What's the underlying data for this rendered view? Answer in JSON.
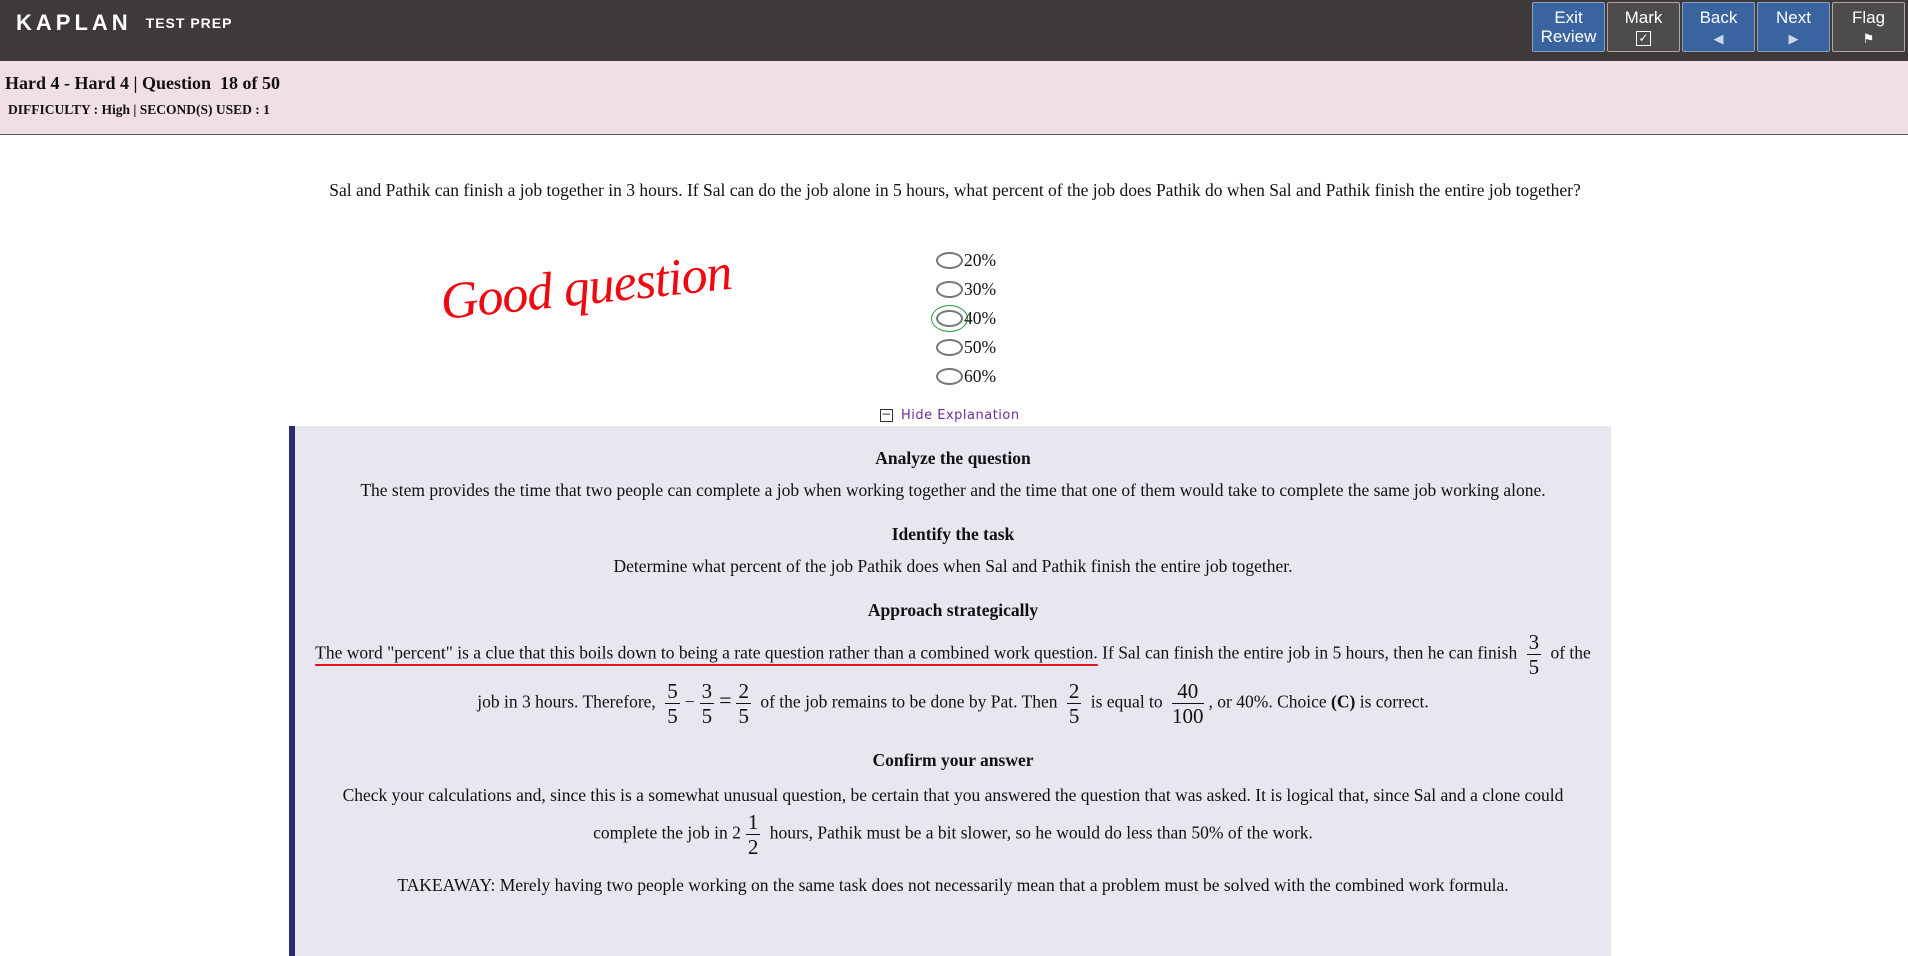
{
  "header": {
    "logo_main": "KAPLAN",
    "logo_sub": "TEST PREP",
    "buttons": [
      {
        "line1": "Exit",
        "line2": "Review"
      },
      {
        "line1": "Mark",
        "icon": "☑"
      },
      {
        "line1": "Back",
        "icon": "◀"
      },
      {
        "line1": "Next",
        "icon": "▶"
      },
      {
        "line1": "Flag",
        "icon": "⚑"
      }
    ]
  },
  "info": {
    "title": "Hard 4 - Hard 4 | Question  18 of 50",
    "subtitle": "DIFFICULTY : High | SECOND(S) USED : 1"
  },
  "question": "Sal and Pathik can finish a job together in 3 hours. If Sal can do the job alone in 5 hours, what percent of the job does Pathik do when Sal and Pathik finish the entire job together?",
  "choices": [
    "20%",
    "30%",
    "40%",
    "50%",
    "60%"
  ],
  "annotation": "Good question",
  "hide_label": "Hide Explanation",
  "explanation": {
    "h1": "Analyze the question",
    "p1": "The stem provides the time that two people can complete a job when working together and the time that one of them would take to complete the same job working alone.",
    "h2": "Identify the task",
    "p2": "Determine what percent of the job Pathik does when Sal and Pathik finish the entire job together.",
    "h3": "Approach strategically",
    "p3a": "The word \"percent\" is a clue that this boils down to being a rate question rather than a combined work question.",
    "p3b": " If Sal can finish the entire job in 5 hours, then he can finish ",
    "p3c": " of the job in 3 hours. Therefore, ",
    "p3d": " of the job remains to be done by Pat. Then ",
    "p3e": " is equal to ",
    "p3f": ", or 40%. Choice ",
    "p3g": "(C)",
    "p3h": " is correct.",
    "fr": {
      "a": [
        "3",
        "5"
      ],
      "b": [
        "5",
        "5"
      ],
      "c": [
        "3",
        "5"
      ],
      "d": [
        "2",
        "5"
      ],
      "e": [
        "2",
        "5"
      ],
      "f": [
        "40",
        "100"
      ]
    },
    "minus": "−",
    "eq": "=",
    "h4": "Confirm your answer",
    "p4a": "Check your calculations and, since this is a somewhat unusual question, be certain that you answered the question that was asked. It is logical that, since Sal and a clone could complete the job in 2",
    "p4frac": [
      "1",
      "2"
    ],
    "p4b": " hours, Pathik must be a bit slower, so he would do less than 50% of the work.",
    "takeaway": "TAKEAWAY: Merely having two people working on the same task does not necessarily mean that a problem must be solved with the combined work formula."
  }
}
